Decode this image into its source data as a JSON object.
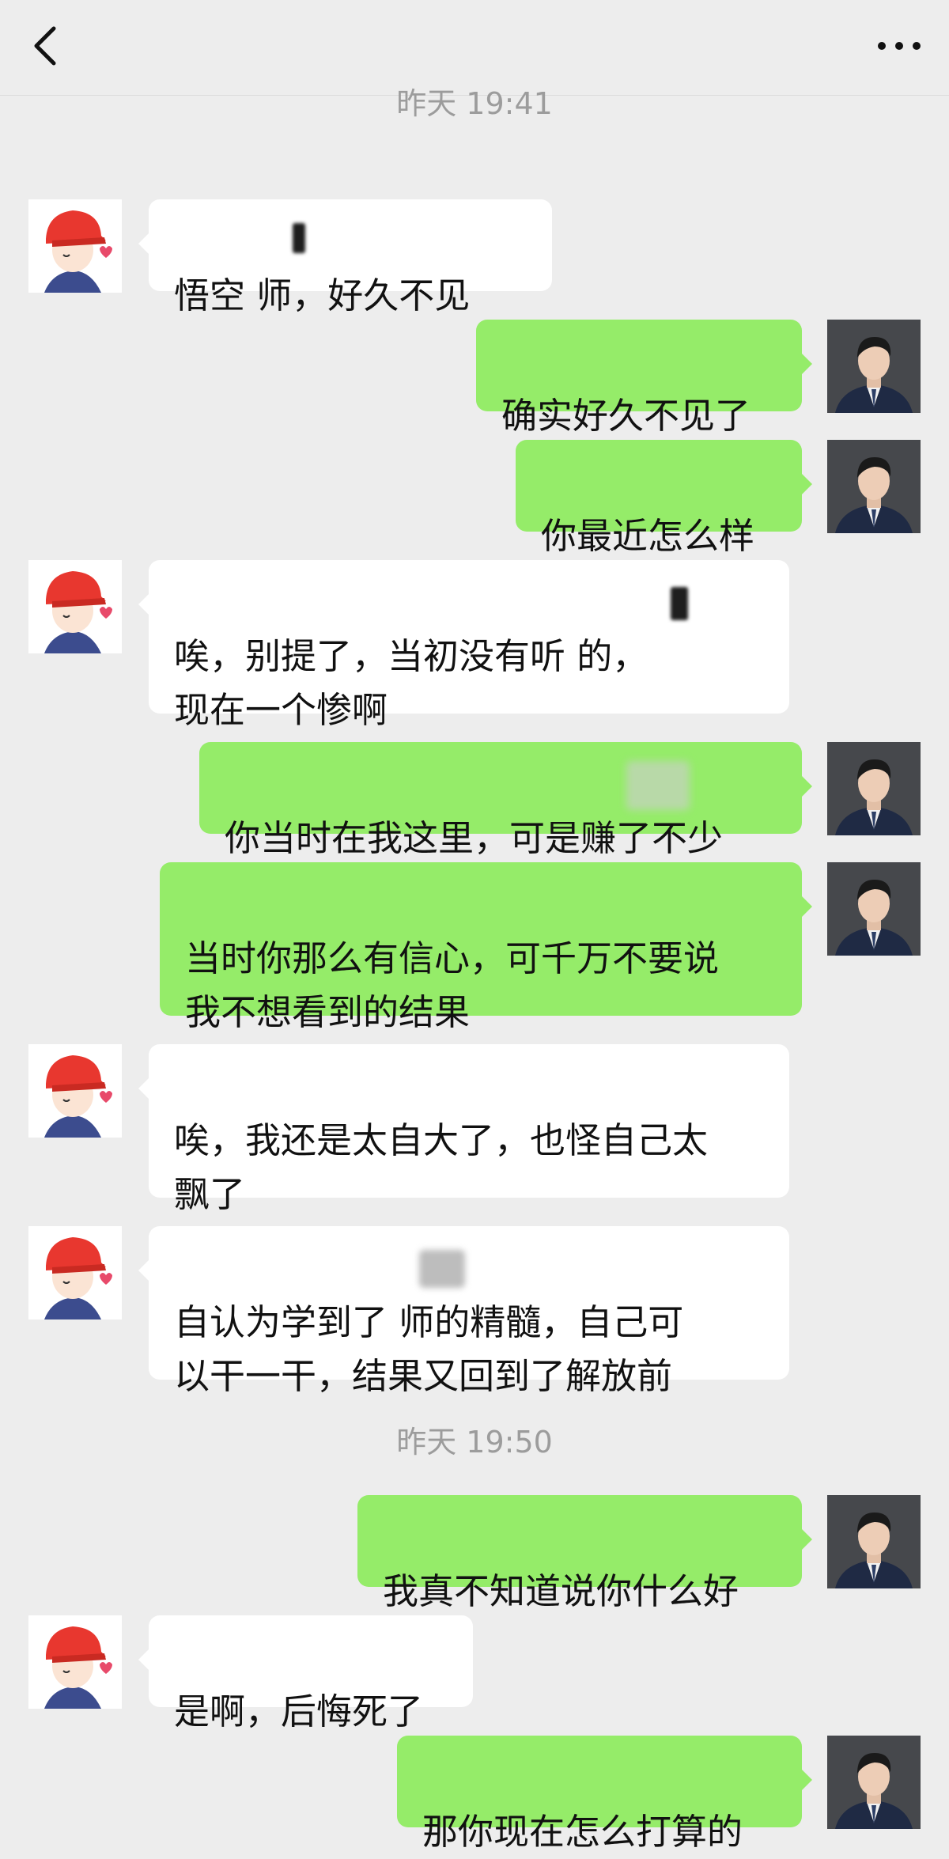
{
  "header": {
    "back_icon": "chevron-left-icon",
    "more_icon": "ellipsis-icon"
  },
  "timestamps": [
    "昨天 19:41",
    "昨天 19:50"
  ],
  "messages": [
    {
      "side": "left",
      "text": "悟空     师，好久不见"
    },
    {
      "side": "right",
      "text": "确实好久不见了"
    },
    {
      "side": "right",
      "text": "你最近怎么样"
    },
    {
      "side": "left",
      "text": "唉，别提了，当初没有听      的，\n现在一个惨啊"
    },
    {
      "side": "right",
      "text": "你当时在我这里，可是赚了不少"
    },
    {
      "side": "right",
      "text": "当时你那么有信心，可千万不要说\n我不想看到的结果"
    },
    {
      "side": "left",
      "text": "唉，我还是太自大了，也怪自己太\n飘了"
    },
    {
      "side": "left",
      "text": "自认为学到了   师的精髓，自己可\n以干一干，结果又回到了解放前"
    },
    {
      "side": "right",
      "text": "我真不知道说你什么好"
    },
    {
      "side": "left",
      "text": "是啊，后悔死了"
    },
    {
      "side": "right",
      "text": "那你现在怎么打算的"
    }
  ],
  "colors": {
    "background": "#ededed",
    "bubble_self": "#95ec69",
    "bubble_other": "#ffffff",
    "timestamp": "#9c9c9c"
  }
}
